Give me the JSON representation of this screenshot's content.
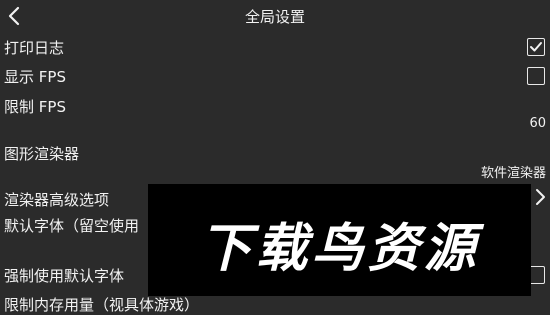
{
  "header": {
    "title": "全局设置",
    "back_icon": "chevron-left-icon"
  },
  "settings": {
    "print_log": {
      "label": "打印日志",
      "checked": true
    },
    "show_fps": {
      "label": "显示 FPS",
      "checked": false
    },
    "limit_fps": {
      "label": "限制 FPS",
      "value": "60"
    },
    "renderer": {
      "label": "图形渲染器",
      "value": "软件渲染器"
    },
    "renderer_advanced": {
      "label": "渲染器高级选项",
      "icon": "chevron-right-icon"
    },
    "default_font": {
      "label": "默认字体（留空使用"
    },
    "force_default_font": {
      "label": "强制使用默认字体",
      "checked": false
    },
    "memory_limit": {
      "label": "限制内存用量（视具体游戏）"
    }
  },
  "watermark": {
    "text": "下载鸟资源"
  }
}
